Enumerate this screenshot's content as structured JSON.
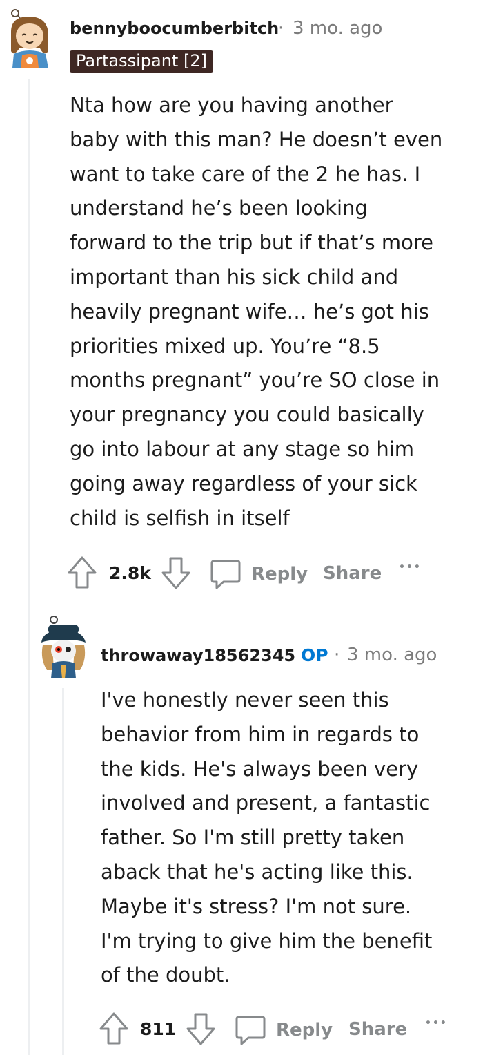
{
  "comments": [
    {
      "username": "bennyboocumberbitch",
      "separator": "·",
      "time": "3 mo. ago",
      "flair": "Partassipant [2]",
      "body": "Nta how are you having another\nbaby with this man? He doesn’t even\nwant to take care of the 2 he has. I\nunderstand he’s been looking\nforward to the trip but if that’s more\nimportant than his sick child and\nheavily pregnant wife… he’s got his\npriorities mixed up. You’re “8.5\nmonths pregnant” you’re SO close in\nyour pregnancy you could basically\ngo into labour at any stage so him\ngoing away regardless of your sick\nchild is selfish in itself",
      "score": "2.8k",
      "reply_label": "Reply",
      "share_label": "Share",
      "more_label": "•••"
    },
    {
      "username": "throwaway18562345",
      "op_badge": "OP",
      "separator": "·",
      "time": "3 mo. ago",
      "body": "I've honestly never seen this\nbehavior from him in regards to\nthe kids. He's always been very\ninvolved and present, a fantastic\nfather. So I'm still pretty taken\naback that he's acting like this.\nMaybe it's stress? I'm not sure.\nI'm trying to give him the benefit\nof the doubt.",
      "score": "811",
      "reply_label": "Reply",
      "share_label": "Share",
      "more_label": "•••"
    }
  ],
  "colors": {
    "flair_bg": "#3e2723",
    "op_blue": "#0079d3",
    "meta_gray": "#7c7c7c",
    "action_gray": "#878a8c",
    "thread_line": "#edeff1"
  }
}
